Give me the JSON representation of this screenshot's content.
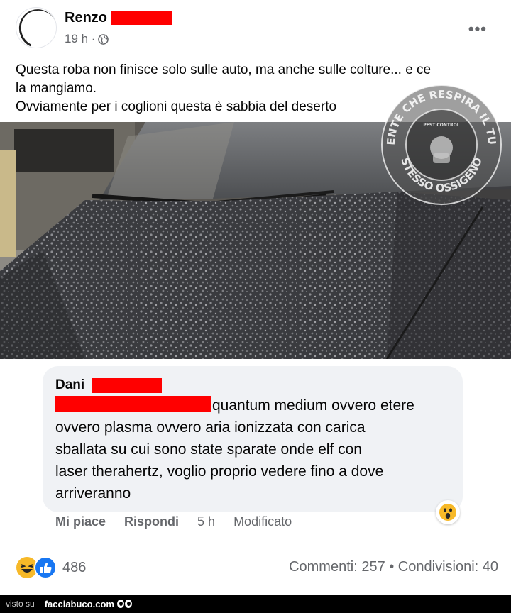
{
  "post": {
    "author": "Renzo",
    "time": "19 h ·",
    "more_label": "•••",
    "text_lines": [
      "Questa roba non finisce solo sulle auto, ma anche sulle colture... e ce",
      "la mangiamo.",
      "Ovviamente per i coglioni questa è sabbia del deserto"
    ]
  },
  "watermark": {
    "top_text": "GENTE CHE RESPIRA IL TUO",
    "bottom_text": "STESSO OSSIGENO",
    "badge": "PEST CONTROL"
  },
  "comment": {
    "author": "Dani",
    "lines": [
      "quantum medium ovvero etere",
      "ovvero plasma ovvero aria ionizzata con carica",
      "sballata su cui sono state sparate onde elf con",
      "laser therahertz, voglio proprio vedere fino a dove",
      "arriveranno"
    ],
    "like_label": "Mi piace",
    "reply_label": "Rispondi",
    "time": "5 h",
    "edited_label": "Modificato"
  },
  "stats": {
    "reactions_count": "486",
    "counts_text": "Commenti: 257 • Condivisioni: 40"
  },
  "footer": {
    "visto_label": "visto su",
    "site": "facciabuco.com"
  },
  "colors": {
    "redaction": "#ff0000",
    "like_blue": "#1877f2",
    "haha_yellow": "#f7b928"
  }
}
